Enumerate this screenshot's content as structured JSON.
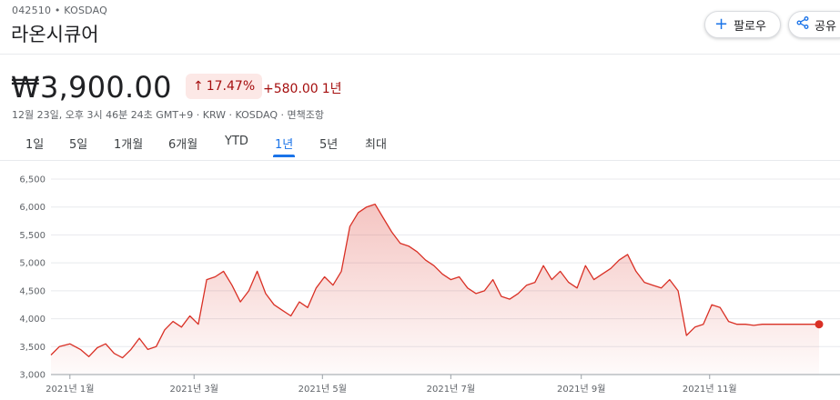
{
  "header": {
    "ticker": "042510 • KOSDAQ",
    "company": "라온시큐어",
    "follow_label": "팔로우",
    "share_label": "공유",
    "follow_icon": "plus-icon",
    "share_icon": "share-icon",
    "accent_color": "#1a73e8"
  },
  "quote": {
    "price": "₩3,900.00",
    "change_percent": "17.47%",
    "change_amount": "+580.00",
    "period": "1년",
    "meta": "12월 23일, 오후 3시 46분 24초 GMT+9 · KRW · KOSDAQ · 면책조항",
    "up_color": "#a50e0e"
  },
  "tabs": [
    {
      "label": "1일",
      "active": false
    },
    {
      "label": "5일",
      "active": false
    },
    {
      "label": "1개월",
      "active": false
    },
    {
      "label": "6개월",
      "active": false
    },
    {
      "label": "YTD",
      "active": false
    },
    {
      "label": "1년",
      "active": true
    },
    {
      "label": "5년",
      "active": false
    },
    {
      "label": "최대",
      "active": false
    }
  ],
  "chart_data": {
    "type": "area",
    "title": "",
    "xlabel": "",
    "ylabel": "",
    "ylim": [
      3000,
      6500
    ],
    "yticks": [
      3000,
      3500,
      4000,
      4500,
      5000,
      5500,
      6000,
      6500
    ],
    "ytick_labels": [
      "3,000",
      "3,500",
      "4,000",
      "4,500",
      "5,000",
      "5,500",
      "6,000",
      "6,500"
    ],
    "xlim": [
      "2020-12-23",
      "2021-12-23"
    ],
    "xticks": [
      {
        "label": "2021년 1월",
        "date": "2021-01-01"
      },
      {
        "label": "2021년 3월",
        "date": "2021-03-01"
      },
      {
        "label": "2021년 5월",
        "date": "2021-05-01"
      },
      {
        "label": "2021년 7월",
        "date": "2021-07-01"
      },
      {
        "label": "2021년 9월",
        "date": "2021-09-01"
      },
      {
        "label": "2021년 11월",
        "date": "2021-11-01"
      }
    ],
    "line_color": "#d93025",
    "series": [
      {
        "x": [
          "2020-12-23",
          "2020-12-27",
          "2021-01-01",
          "2021-01-06",
          "2021-01-10",
          "2021-01-14",
          "2021-01-18",
          "2021-01-22",
          "2021-01-26",
          "2021-01-30",
          "2021-02-03",
          "2021-02-07",
          "2021-02-11",
          "2021-02-15",
          "2021-02-19",
          "2021-02-23",
          "2021-02-27",
          "2021-03-03",
          "2021-03-07",
          "2021-03-11",
          "2021-03-15",
          "2021-03-19",
          "2021-03-23",
          "2021-03-27",
          "2021-03-31",
          "2021-04-04",
          "2021-04-08",
          "2021-04-12",
          "2021-04-16",
          "2021-04-20",
          "2021-04-24",
          "2021-04-28",
          "2021-05-02",
          "2021-05-06",
          "2021-05-10",
          "2021-05-14",
          "2021-05-18",
          "2021-05-22",
          "2021-05-26",
          "2021-05-30",
          "2021-06-03",
          "2021-06-07",
          "2021-06-11",
          "2021-06-15",
          "2021-06-19",
          "2021-06-23",
          "2021-06-27",
          "2021-07-01",
          "2021-07-05",
          "2021-07-09",
          "2021-07-13",
          "2021-07-17",
          "2021-07-21",
          "2021-07-25",
          "2021-07-29",
          "2021-08-02",
          "2021-08-06",
          "2021-08-10",
          "2021-08-14",
          "2021-08-18",
          "2021-08-22",
          "2021-08-26",
          "2021-08-30",
          "2021-09-03",
          "2021-09-07",
          "2021-09-11",
          "2021-09-15",
          "2021-09-19",
          "2021-09-23",
          "2021-09-27",
          "2021-10-01",
          "2021-10-05",
          "2021-10-09",
          "2021-10-13",
          "2021-10-17",
          "2021-10-21",
          "2021-10-25",
          "2021-10-29",
          "2021-11-02",
          "2021-11-06",
          "2021-11-10",
          "2021-11-14",
          "2021-11-18",
          "2021-11-22",
          "2021-11-26",
          "2021-11-30",
          "2021-12-04",
          "2021-12-08",
          "2021-12-12",
          "2021-12-16",
          "2021-12-20",
          "2021-12-23"
        ],
        "values": [
          3350,
          3500,
          3550,
          3450,
          3320,
          3480,
          3550,
          3380,
          3300,
          3450,
          3650,
          3450,
          3500,
          3800,
          3950,
          3850,
          4050,
          3900,
          4700,
          4750,
          4850,
          4600,
          4300,
          4500,
          4850,
          4450,
          4250,
          4150,
          4050,
          4300,
          4200,
          4550,
          4750,
          4600,
          4850,
          5650,
          5900,
          6000,
          6050,
          5800,
          5550,
          5350,
          5300,
          5200,
          5050,
          4950,
          4800,
          4700,
          4750,
          4550,
          4450,
          4500,
          4700,
          4400,
          4350,
          4450,
          4600,
          4650,
          4950,
          4700,
          4850,
          4650,
          4550,
          4950,
          4700,
          4800,
          4900,
          5050,
          5150,
          4850,
          4650,
          4600,
          4550,
          4700,
          4500,
          3700,
          3850,
          3900,
          4250,
          4200,
          3950,
          3900,
          3900,
          3880,
          3900,
          3900,
          3900,
          3900,
          3900,
          3900,
          3900,
          3900
        ]
      }
    ]
  }
}
